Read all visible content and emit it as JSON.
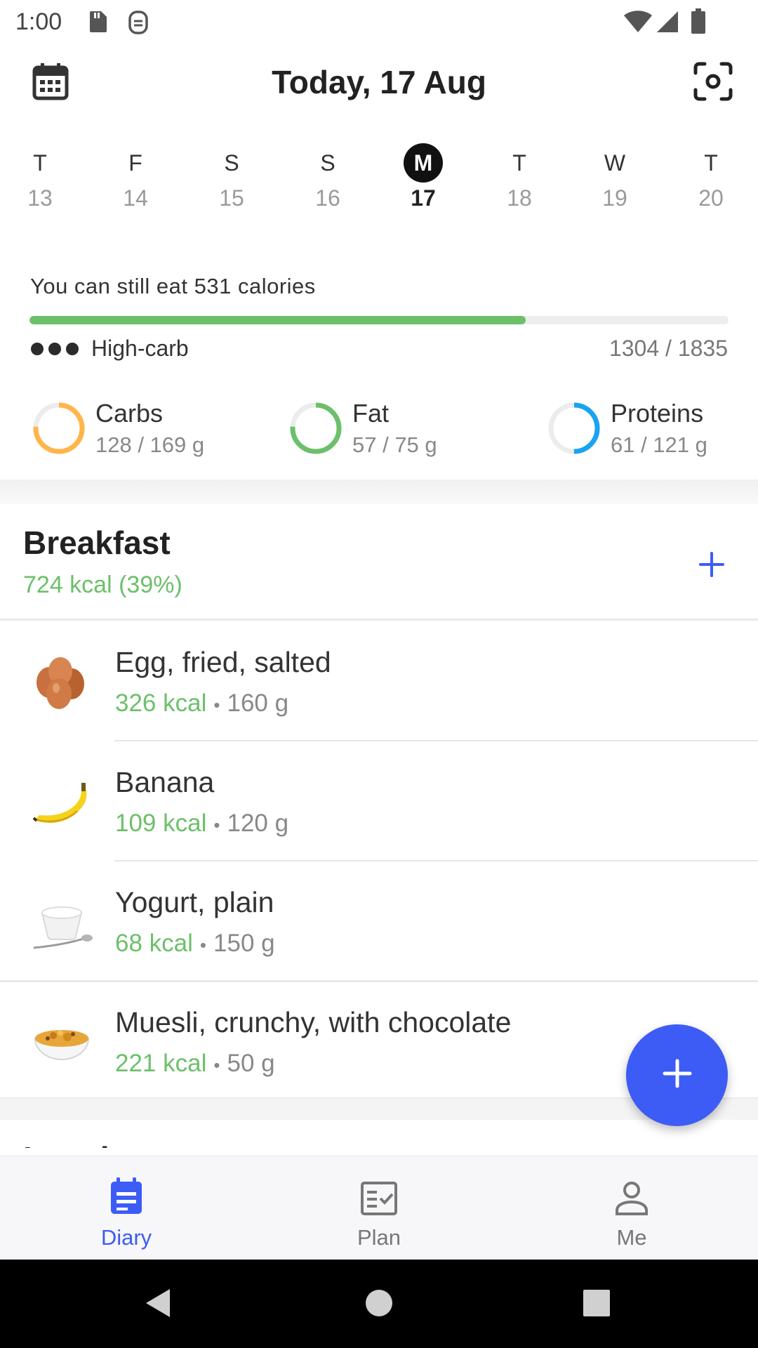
{
  "status_bar": {
    "time": "1:00",
    "icons": [
      "sd-card-icon",
      "sim-icon",
      "wifi-icon",
      "signal-icon",
      "battery-icon"
    ]
  },
  "header": {
    "title": "Today, 17 Aug",
    "left_icon": "calendar-icon",
    "right_icon": "scan-icon"
  },
  "week": [
    {
      "letter": "T",
      "num": "13"
    },
    {
      "letter": "F",
      "num": "14"
    },
    {
      "letter": "S",
      "num": "15"
    },
    {
      "letter": "S",
      "num": "16"
    },
    {
      "letter": "M",
      "num": "17",
      "selected": true
    },
    {
      "letter": "T",
      "num": "18"
    },
    {
      "letter": "W",
      "num": "19"
    },
    {
      "letter": "T",
      "num": "20"
    }
  ],
  "summary": {
    "remaining_text": "You can still eat 531 calories",
    "progress_fraction": 0.71,
    "diet_label": "High-carb",
    "calories": "1304 / 1835",
    "progress_color": "#6cc06a"
  },
  "macros": [
    {
      "name": "Carbs",
      "value": "128 / 169 g",
      "fraction": 0.76,
      "color": "#ffb547"
    },
    {
      "name": "Fat",
      "value": "57 / 75 g",
      "fraction": 0.76,
      "color": "#6cc06a"
    },
    {
      "name": "Proteins",
      "value": "61 / 121 g",
      "fraction": 0.5,
      "color": "#1aa3f0"
    }
  ],
  "meal": {
    "title": "Breakfast",
    "kcal": "724 kcal (39%)",
    "items": [
      {
        "name": "Egg, fried, salted",
        "kcal": "326 kcal",
        "amount": "160 g",
        "icon": "eggs-icon"
      },
      {
        "name": "Banana",
        "kcal": "109 kcal",
        "amount": "120 g",
        "icon": "banana-icon"
      },
      {
        "name": "Yogurt, plain",
        "kcal": "68 kcal",
        "amount": "150 g",
        "icon": "yogurt-icon"
      },
      {
        "name": "Muesli, crunchy, with chocolate",
        "kcal": "221 kcal",
        "amount": "50 g",
        "icon": "muesli-icon"
      }
    ]
  },
  "next_meal": {
    "title": "Lunch"
  },
  "separator": "•",
  "bottom_nav": [
    {
      "label": "Diary",
      "icon": "diary-icon",
      "active": true
    },
    {
      "label": "Plan",
      "icon": "plan-icon"
    },
    {
      "label": "Me",
      "icon": "person-icon"
    }
  ],
  "colors": {
    "accent": "#3d5cf5",
    "green": "#6cc06a"
  }
}
